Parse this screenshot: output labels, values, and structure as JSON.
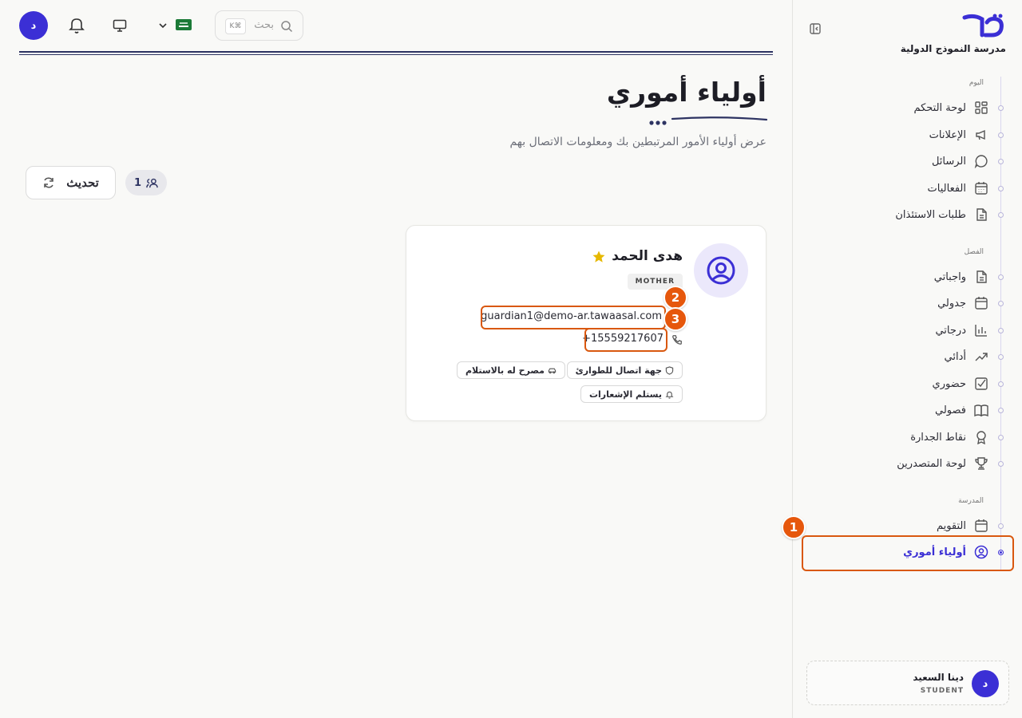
{
  "sidebar": {
    "school_name": "مدرسة النموذج الدولية",
    "groups": [
      {
        "label": "اليوم"
      },
      {
        "label": "الفصل"
      },
      {
        "label": "المدرسة"
      }
    ],
    "items": [
      {
        "label": "لوحة التحكم",
        "icon": "dashboard-icon"
      },
      {
        "label": "الإعلانات",
        "icon": "megaphone-icon"
      },
      {
        "label": "الرسائل",
        "icon": "chat-icon"
      },
      {
        "label": "الفعاليات",
        "icon": "calendar-grid-icon"
      },
      {
        "label": "طلبات الاستئذان",
        "icon": "document-icon"
      },
      {
        "label": "واجباتي",
        "icon": "document-icon"
      },
      {
        "label": "جدولي",
        "icon": "calendar-icon"
      },
      {
        "label": "درجاتي",
        "icon": "bar-chart-icon"
      },
      {
        "label": "أدائي",
        "icon": "trend-up-icon"
      },
      {
        "label": "حضوري",
        "icon": "checkbox-icon"
      },
      {
        "label": "فصولي",
        "icon": "book-icon"
      },
      {
        "label": "نقاط الجدارة",
        "icon": "award-icon"
      },
      {
        "label": "لوحة المتصدرين",
        "icon": "trophy-icon"
      },
      {
        "label": "التقويم",
        "icon": "calendar-icon"
      },
      {
        "label": "أولياء أموري",
        "icon": "user-circle-icon",
        "active": true
      }
    ],
    "user": {
      "initial": "د",
      "name": "دينا السعيد",
      "role": "STUDENT"
    }
  },
  "topbar": {
    "avatar_initial": "د",
    "search": {
      "placeholder": "بحث",
      "shortcut": "K⌘"
    }
  },
  "page": {
    "title": "أولياء أموري",
    "subtitle": "عرض أولياء الأمور المرتبطين بك ومعلومات الاتصال بهم",
    "refresh_label": "تحديث",
    "count": "1"
  },
  "guardian": {
    "name": "هدى الحمد",
    "relation": "MOTHER",
    "email": "guardian1@demo-ar.tawaasal.com",
    "phone": "+15559217607",
    "tags": [
      "جهة اتصال للطوارئ",
      "مصرح له بالاستلام",
      "يستلم الإشعارات"
    ]
  },
  "annotations": [
    "1",
    "2",
    "3"
  ],
  "colors": {
    "accent": "#3b2fd5",
    "annotation": "#e6570c",
    "navy": "#2d3362"
  }
}
